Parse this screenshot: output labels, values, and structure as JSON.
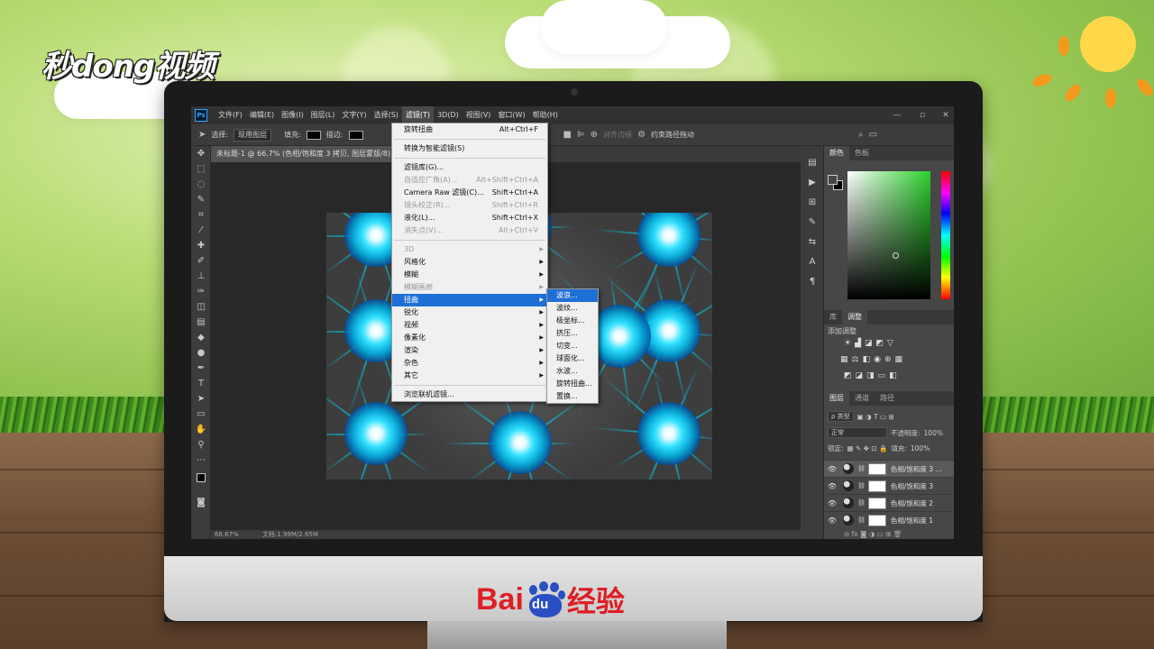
{
  "scene": {
    "watermark": "秒dong视频",
    "brand_bai": "Bai",
    "brand_du": "du",
    "brand_suffix": "经验"
  },
  "app": {
    "icon": "Ps",
    "menubar": [
      "文件(F)",
      "编辑(E)",
      "图像(I)",
      "图层(L)",
      "文字(Y)",
      "选择(S)",
      "滤镜(T)",
      "3D(D)",
      "视图(V)",
      "窗口(W)",
      "帮助(H)"
    ],
    "active_menu_index": 6,
    "window_controls": [
      "—",
      "▫",
      "✕"
    ]
  },
  "options": {
    "select_label": "选择:",
    "select_value": "现用图层",
    "fill_label": "填充:",
    "stroke_label": "描边:",
    "align_edges": "对齐边缘",
    "constrain_path": "约束路径拖动"
  },
  "document": {
    "tab_title": "未标题-1 @ 66.7% (色相/饱和度 3 拷贝, 图层蒙版/8) *",
    "zoom": "66.67%",
    "doc_size": "文档:1.99M/2.65M"
  },
  "filter_menu": {
    "items": [
      {
        "label": "旋转扭曲",
        "shortcut": "Alt+Ctrl+F",
        "disabled": false
      },
      {
        "sep": true
      },
      {
        "label": "转换为智能滤镜(S)",
        "shortcut": "",
        "disabled": false
      },
      {
        "sep": true
      },
      {
        "label": "滤镜库(G)...",
        "shortcut": "",
        "disabled": false
      },
      {
        "label": "自适应广角(A)...",
        "shortcut": "Alt+Shift+Ctrl+A",
        "disabled": true
      },
      {
        "label": "Camera Raw 滤镜(C)...",
        "shortcut": "Shift+Ctrl+A",
        "disabled": false
      },
      {
        "label": "镜头校正(R)...",
        "shortcut": "Shift+Ctrl+R",
        "disabled": true
      },
      {
        "label": "液化(L)...",
        "shortcut": "Shift+Ctrl+X",
        "disabled": false
      },
      {
        "label": "消失点(V)...",
        "shortcut": "Alt+Ctrl+V",
        "disabled": true
      },
      {
        "sep": true
      },
      {
        "label": "3D",
        "sub": true,
        "disabled": true
      },
      {
        "label": "风格化",
        "sub": true,
        "disabled": false
      },
      {
        "label": "模糊",
        "sub": true,
        "disabled": false
      },
      {
        "label": "模糊画廊",
        "sub": true,
        "disabled": true
      },
      {
        "label": "扭曲",
        "sub": true,
        "disabled": false,
        "highlight": true
      },
      {
        "label": "锐化",
        "sub": true,
        "disabled": false
      },
      {
        "label": "视频",
        "sub": true,
        "disabled": false
      },
      {
        "label": "像素化",
        "sub": true,
        "disabled": false
      },
      {
        "label": "渲染",
        "sub": true,
        "disabled": false
      },
      {
        "label": "杂色",
        "sub": true,
        "disabled": false
      },
      {
        "label": "其它",
        "sub": true,
        "disabled": false
      },
      {
        "sep": true
      },
      {
        "label": "浏览联机滤镜...",
        "shortcut": "",
        "disabled": false
      }
    ]
  },
  "distort_submenu": {
    "items": [
      "波浪...",
      "波纹...",
      "极坐标...",
      "挤压...",
      "切变...",
      "球面化...",
      "水波...",
      "旋转扭曲...",
      "置换..."
    ],
    "highlight_index": 0
  },
  "color_panel": {
    "tabs": [
      "颜色",
      "色板"
    ],
    "active": 0
  },
  "adjust_panel": {
    "tabs": [
      "库",
      "调整"
    ],
    "active": 1,
    "title": "添加调整"
  },
  "layers_panel": {
    "tabs": [
      "图层",
      "通道",
      "路径"
    ],
    "active": 0,
    "filter_kind": "ρ 类型",
    "blend_mode": "正常",
    "opacity_label": "不透明度:",
    "opacity_value": "100%",
    "lock_label": "锁定:",
    "fill_label": "填充:",
    "fill_value": "100%",
    "layers": [
      {
        "name": "色相/饱和度 3 ...",
        "selected": true
      },
      {
        "name": "色相/饱和度 3",
        "selected": false
      },
      {
        "name": "色相/饱和度 2",
        "selected": false
      },
      {
        "name": "色相/饱和度 1",
        "selected": false
      }
    ]
  },
  "colors": {
    "menu_highlight": "#1e6fd6",
    "ps_dark": "#323232",
    "accent_cyan": "#33e2ff",
    "baidu_red": "#de1e26",
    "baidu_blue": "#2a4fc3"
  }
}
